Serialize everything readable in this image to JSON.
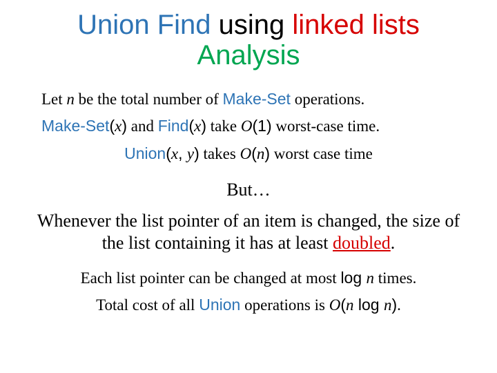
{
  "title": {
    "p1": "Union Find",
    "p2": " using ",
    "p3": "linked lists",
    "p4": "Analysis"
  },
  "l1": {
    "a": "Let ",
    "n": "n",
    "b": " be the total number of ",
    "op": "Make-Set",
    "c": " operations."
  },
  "l2": {
    "op1": "Make-Set",
    "arg1_l": "(",
    "x": "x",
    "arg1_r": ")",
    "and": " and ",
    "op2": "Find",
    "arg2_l": "(",
    "x2": "x",
    "arg2_r": ")",
    "take": " take ",
    "O": "O",
    "p_l": "(",
    "one": "1",
    "p_r": ")",
    "tail": " worst-case time."
  },
  "l3": {
    "op": "Union",
    "arg_l": "(",
    "x": "x",
    "comma": ", ",
    "y": "y",
    "arg_r": ")",
    "takes": " takes ",
    "O": "O",
    "p_l": "(",
    "n": "n",
    "p_r": ")",
    "tail": " worst case time"
  },
  "but": "But…",
  "para": {
    "a": "Whenever the list pointer of an item is changed, the size of the list containing it has at least ",
    "d": "doubled",
    "dot": "."
  },
  "l4": {
    "a": "Each list pointer can be changed at most ",
    "log": "log ",
    "n": "n",
    "b": " times."
  },
  "l5": {
    "a": "Total cost of all ",
    "op": "Union",
    "b": " operations is ",
    "O": "O",
    "p_l": "(",
    "n1": "n",
    "log": " log ",
    "n2": "n",
    "p_r": ")",
    "dot": "."
  }
}
